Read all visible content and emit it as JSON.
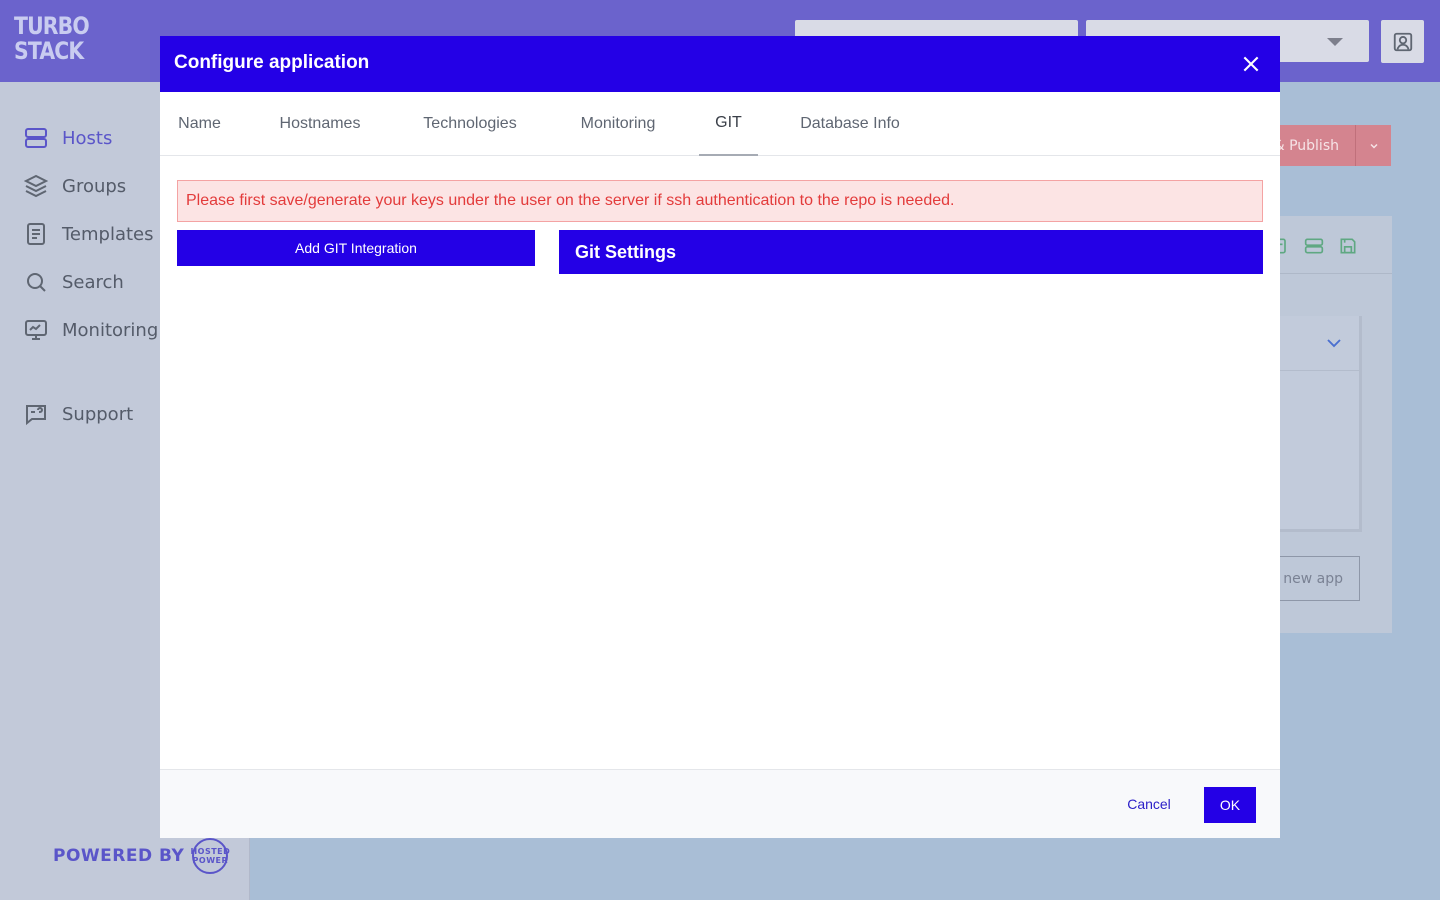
{
  "brand": {
    "logo_line1": "TURBO",
    "logo_line2": "STACK",
    "powered_by": "POWERED BY",
    "powered_badge_line1": "HOSTED",
    "powered_badge_line2": "POWER"
  },
  "sidebar": {
    "items": [
      {
        "label": "Hosts",
        "icon": "server-icon",
        "active": true
      },
      {
        "label": "Groups",
        "icon": "layers-icon"
      },
      {
        "label": "Templates",
        "icon": "document-icon"
      },
      {
        "label": "Search",
        "icon": "search-icon"
      },
      {
        "label": "Monitoring",
        "icon": "monitor-icon"
      },
      {
        "label": "Support",
        "icon": "chat-help-icon"
      }
    ]
  },
  "background": {
    "publish_label": "& Publish",
    "new_app_label": "l new app"
  },
  "modal": {
    "title": "Configure application",
    "tabs": [
      {
        "label": "Name"
      },
      {
        "label": "Hostnames"
      },
      {
        "label": "Technologies"
      },
      {
        "label": "Monitoring"
      },
      {
        "label": "GIT",
        "active": true
      },
      {
        "label": "Database Info"
      }
    ],
    "alert": "Please first save/generate your keys under the user on the server if ssh authentication to the repo is needed.",
    "add_git_label": "Add GIT Integration",
    "git_settings_title": "Git Settings",
    "cancel_label": "Cancel",
    "ok_label": "OK"
  },
  "colors": {
    "primary": "#2400e6",
    "topbar": "#6b63cc",
    "alert_text": "#e33b3b",
    "alert_bg": "#fce4e4"
  }
}
